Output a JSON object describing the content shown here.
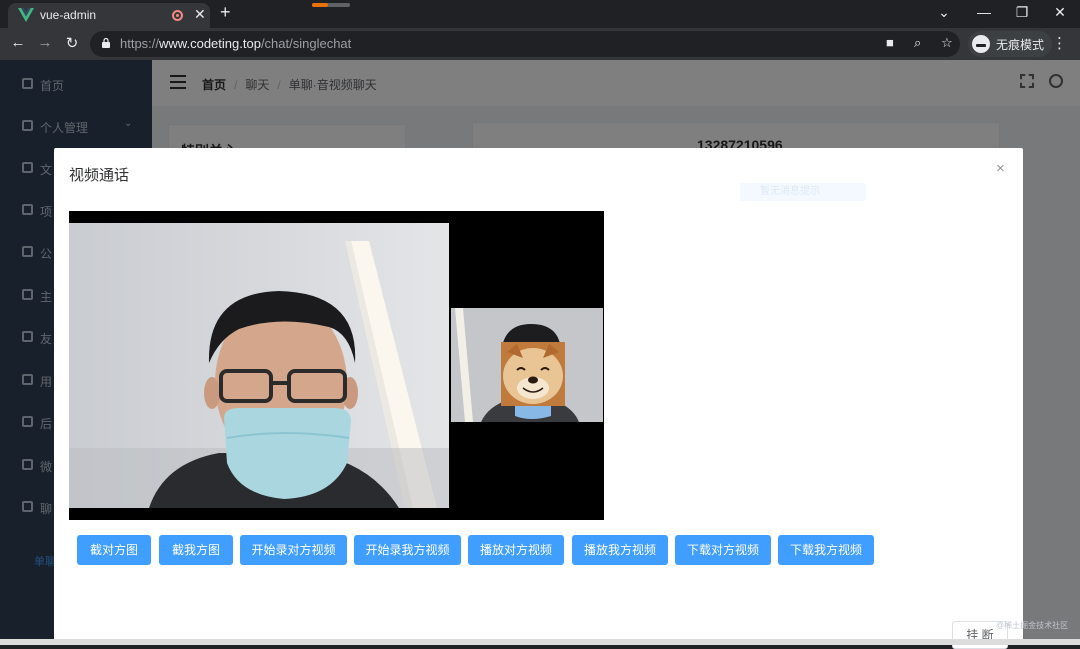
{
  "browser": {
    "tab_title": "vue-admin",
    "tab_close": "✕",
    "new_tab": "+",
    "url_scheme": "https://",
    "url_host": "www.codeting.top",
    "url_path": "/chat/singlechat",
    "incognito_label": "无痕模式",
    "window_controls": {
      "minimize": "—",
      "restore": "❐",
      "close": "✕"
    },
    "icons": [
      "back-arrow-icon",
      "forward-arrow-icon",
      "reload-icon",
      "lock-icon",
      "camera-icon",
      "zoom-icon",
      "star-icon",
      "incognito-icon",
      "menu-dots-icon"
    ]
  },
  "page": {
    "sidebar": {
      "items": [
        {
          "label": "首页",
          "icon": "dashboard-icon"
        },
        {
          "label": "个人管理",
          "icon": "list-icon",
          "caret": "⌄"
        },
        {
          "label": "文",
          "icon": "chart-icon"
        },
        {
          "label": "项",
          "icon": "monitor-icon"
        },
        {
          "label": "公",
          "icon": "location-icon"
        },
        {
          "label": "主",
          "icon": "flag-icon"
        },
        {
          "label": "友",
          "icon": "link-icon"
        },
        {
          "label": "用",
          "icon": "flag-icon"
        },
        {
          "label": "后",
          "icon": "camera-icon"
        },
        {
          "label": "微",
          "icon": "book-icon"
        },
        {
          "label": "聊",
          "icon": "chat-icon"
        }
      ],
      "more": "单聊"
    },
    "breadcrumb": {
      "home": "首页",
      "sep": "/",
      "level2": "聊天",
      "level3": "单聊·音视频聊天"
    },
    "card_left_text": "特别关心",
    "card_right_text": "13287210596"
  },
  "dialog": {
    "title": "视频通话",
    "close": "×",
    "faint_tag": "暂无消息提示",
    "buttons": [
      {
        "label": "截对方图"
      },
      {
        "label": "截我方图"
      },
      {
        "label": "开始录对方视频"
      },
      {
        "label": "开始录我方视频"
      },
      {
        "label": "播放对方视频"
      },
      {
        "label": "播放我方视频"
      },
      {
        "label": "下载对方视频"
      },
      {
        "label": "下载我方视频"
      }
    ],
    "hangup": "挂 断"
  },
  "watermark": "@稀土掘金技术社区",
  "colors": {
    "primary": "#409eff",
    "sidebar": "#304156",
    "chrome_dark": "#202124",
    "chrome_toolbar": "#35363a"
  }
}
